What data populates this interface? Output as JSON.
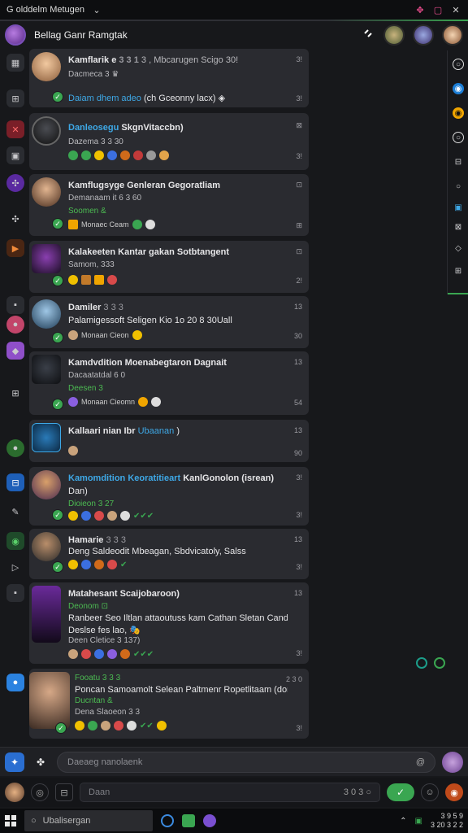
{
  "window": {
    "title": "G olddelm Metugen",
    "chevron": "⌄",
    "controls": [
      "✥",
      "▢",
      "✕"
    ]
  },
  "header": {
    "title": "Bellag Ganr Ramgtak",
    "icons": [
      "link-icon"
    ],
    "colors": {
      "accent": "#3aa651",
      "link": "#3ea8e6"
    }
  },
  "left_rail": {
    "items": [
      "▦",
      "⊞",
      "⊡",
      "✕",
      "▣",
      "✣",
      "▶",
      "▪",
      "●",
      "◆",
      "⊞",
      "✎",
      "●",
      "⊟",
      "◉",
      "▪",
      "▭",
      "▷",
      "▪",
      "●"
    ]
  },
  "right_rail": {
    "items": [
      "○",
      "◉",
      "◉",
      "○",
      "⊟",
      "○",
      "▣",
      "⊠",
      "◇",
      "⊞"
    ]
  },
  "feed": {
    "cards": [
      {
        "title": "Kamflarik e",
        "title_extra": "3 3 1",
        "title_tail": "3 , Mbcarugen Scigo 30!",
        "sub": "Dacmeca 3 ♛",
        "link": "Daiam dhem adeo",
        "tail": "(ch Gceonny lacx) ◈",
        "time": "3!",
        "time_bottom": "3!"
      },
      {
        "title": "Danleosegu",
        "title_tail": "SkgnVitaccbn)",
        "sub": "Dazema 3 3 30",
        "time": "⊠",
        "time_bottom": "3!"
      },
      {
        "title": "Kamflugsyge Genleran Gegoratliam",
        "sub": "Demanaam it 6 3 60",
        "green": "Soomen &",
        "react": "Monaec Ceam",
        "time": "⊡",
        "time_bottom": "⊞"
      },
      {
        "title": "Kalakeeten Kantar gakan Sotbtangent",
        "sub": "Samom, 333",
        "time": "⊡",
        "time_bottom": "2!"
      },
      {
        "title": "Damiler",
        "title_extra": "3 3 3",
        "line2": "Palamigessoft Seligen Kio 1o 20 8 30Uall",
        "react": "Monaan Cieon",
        "time": "13",
        "time_bottom": "30"
      },
      {
        "title": "Kamdvdition Moenabegtaron Dagnait",
        "sub": "Dacaatatdal 6 0",
        "green": "Deesen 3",
        "react": "Monaan Cieomn",
        "time": "13",
        "time_bottom": "54"
      },
      {
        "title": "Kallaari nian Ibr",
        "title_link": "Ubaanan",
        "title_close": ")",
        "time": "13",
        "time_bottom": "90"
      },
      {
        "title_link": "Kamomdition Keoratitieart",
        "title": "KanlGonolon (isrean)",
        "line2": "Dan)",
        "green": "Dioieon 3 27",
        "time": "3!",
        "time_bottom": "3!"
      },
      {
        "title": "Hamarie",
        "title_extra": "3 3 3",
        "line2": "Deng Saldeodit Mbeagan, Sbdvicatoly, Salss",
        "time": "13",
        "time_bottom": "3!"
      },
      {
        "title": "Matahesant Scaijobaroon)",
        "green": "Deonom ⊡",
        "line2": "Ranbeer Seo Iltlan attaoutuss kam Cathan Sletan Candtaj",
        "line3": "Deslse fes lao, 🎭",
        "line4": "Deen Cletice 3 137)",
        "time": "13",
        "time_bottom": "3!"
      },
      {
        "title_green": "Fooatu 3 3 3",
        "line2": "Poncan Samoamolt Selean Paltmenr Ropetlitaam (donagat)",
        "green": "Ducntan &",
        "sub": "Dena Slaoeon 3 3",
        "time": "2 3 0",
        "time_bottom": "3!"
      }
    ]
  },
  "composer": {
    "placeholder": "Daeaeg nanolaenk",
    "at_icon": "@"
  },
  "bottom_input": {
    "placeholder": "Daan",
    "counter": "3 0 3 ○"
  },
  "taskbar": {
    "search": "Ubalisergan",
    "tray_top": "3 9 5 9",
    "tray_bottom": "3 20 3 2 2"
  }
}
